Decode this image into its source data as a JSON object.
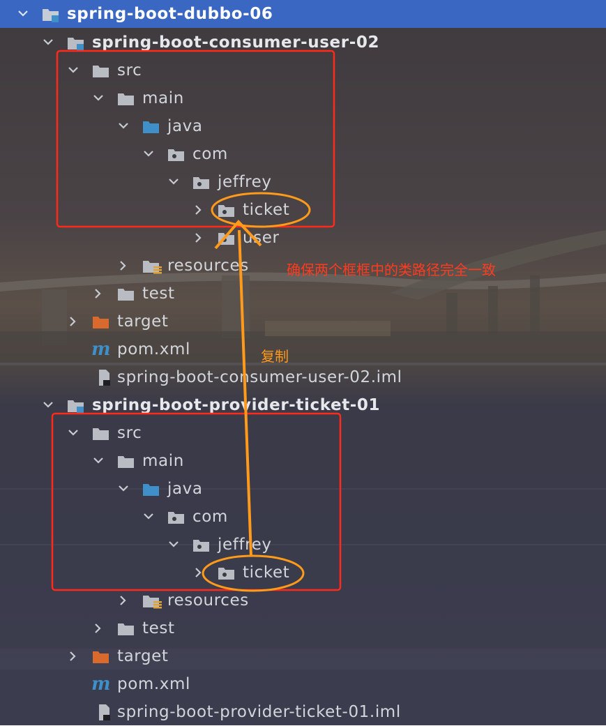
{
  "tree": {
    "root": {
      "label": "spring-boot-dubbo-06"
    },
    "consumer": {
      "module": {
        "label": "spring-boot-consumer-user-02"
      },
      "src": {
        "label": "src"
      },
      "main": {
        "label": "main"
      },
      "java": {
        "label": "java"
      },
      "com": {
        "label": "com"
      },
      "jeffrey": {
        "label": "jeffrey"
      },
      "ticket": {
        "label": "ticket"
      },
      "user": {
        "label": "user"
      },
      "resources": {
        "label": "resources"
      },
      "test": {
        "label": "test"
      },
      "target": {
        "label": "target"
      },
      "pom": {
        "label": "pom.xml"
      },
      "iml": {
        "label": "spring-boot-consumer-user-02.iml"
      }
    },
    "provider": {
      "module": {
        "label": "spring-boot-provider-ticket-01"
      },
      "src": {
        "label": "src"
      },
      "main": {
        "label": "main"
      },
      "java": {
        "label": "java"
      },
      "com": {
        "label": "com"
      },
      "jeffrey": {
        "label": "jeffrey"
      },
      "ticket": {
        "label": "ticket"
      },
      "resources": {
        "label": "resources"
      },
      "test": {
        "label": "test"
      },
      "target": {
        "label": "target"
      },
      "pom": {
        "label": "pom.xml"
      },
      "iml": {
        "label": "spring-boot-provider-ticket-01.iml"
      }
    }
  },
  "annotations": {
    "paths_note": "确保两个框框中的类路径完全一致",
    "copy_note": "复制"
  },
  "colors": {
    "selection": "#3a67c2",
    "red_box": "#ff2a1a",
    "orange": "#ff9a1a",
    "folder": "#b9bdc3",
    "source_folder": "#3f8fc9",
    "excluded_folder": "#d9692c"
  }
}
